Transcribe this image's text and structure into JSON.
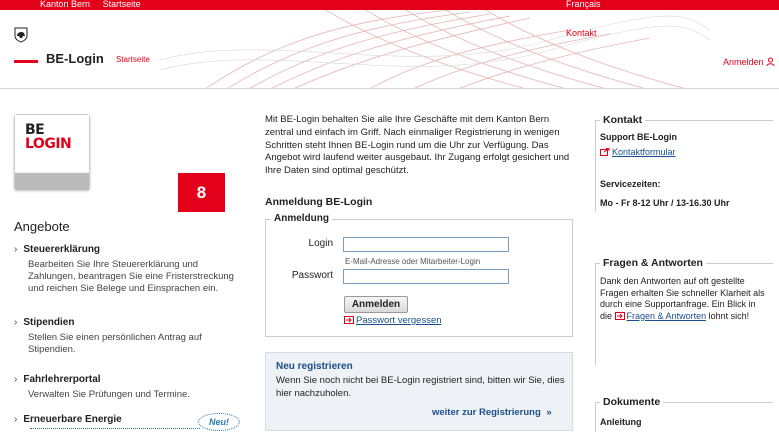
{
  "topbar": {
    "canton": "Kanton Bern",
    "home": "Startseite",
    "language": "Français"
  },
  "header": {
    "contact": "Kontakt",
    "title": "BE-Login",
    "subtitle": "Startseite",
    "login": "Anmelden"
  },
  "logo": {
    "line1": "BE",
    "line2": "LOGIN"
  },
  "badge": "8",
  "offers_title": "Angebote",
  "offers": [
    {
      "title": "Steuererklärung",
      "description": "Bearbeiten Sie Ihre Steuererklärung und Zahlungen, beantragen Sie eine Fristerstreckung und reichen Sie Belege und Einsprachen ein."
    },
    {
      "title": "Stipendien",
      "description": "Stellen Sie einen persönlichen Antrag auf Stipendien."
    },
    {
      "title": "Fahrlehrerportal",
      "description": "Verwalten Sie Prüfungen und Termine."
    },
    {
      "title": "Erneuerbare Energie",
      "description": ""
    }
  ],
  "new_label": "Neu!",
  "intro": "Mit BE-Login behalten Sie alle Ihre Geschäfte mit dem Kanton Bern zentral und einfach im Griff. Nach einmaliger Registrierung in wenigen Schritten steht Ihnen BE-Login rund um die Uhr zur Verfügung. Das Angebot wird laufend weiter ausgebaut. Ihr Zugang erfolgt gesichert und Ihre Daten sind optimal geschützt.",
  "login_section_title": "Anmeldung BE-Login",
  "login_form": {
    "legend": "Anmeldung",
    "login_label": "Login",
    "login_value": "",
    "login_hint": "E-Mail-Adresse oder Mitarbeiter-Login",
    "password_label": "Passwort",
    "password_value": "",
    "submit_label": "Anmelden",
    "forgot_password": "Passwort vergessen"
  },
  "register": {
    "title": "Neu registrieren",
    "text": "Wenn Sie noch nicht bei BE-Login registriert sind, bitten wir Sie, dies hier nachzuholen.",
    "link": "weiter zur Registrierung"
  },
  "contact_box": {
    "title": "Kontakt",
    "support": "Support BE-Login",
    "form_link": "Kontaktformular",
    "hours_title": "Servicezeiten:",
    "hours": "Mo - Fr 8-12 Uhr / 13-16.30 Uhr"
  },
  "faq_box": {
    "title": "Fragen & Antworten",
    "text_before": "Dank den Antworten auf oft gestellte Fragen erhalten Sie schneller Klarheit als durch eine Supportanfrage. Ein Blick in die",
    "link": "Fragen & Antworten",
    "text_after": "lohnt sich!"
  },
  "documents_box": {
    "title": "Dokumente",
    "first_item": "Anleitung"
  },
  "colors": {
    "brand_red": "#e2001a",
    "link_blue": "#1a4f8a"
  }
}
